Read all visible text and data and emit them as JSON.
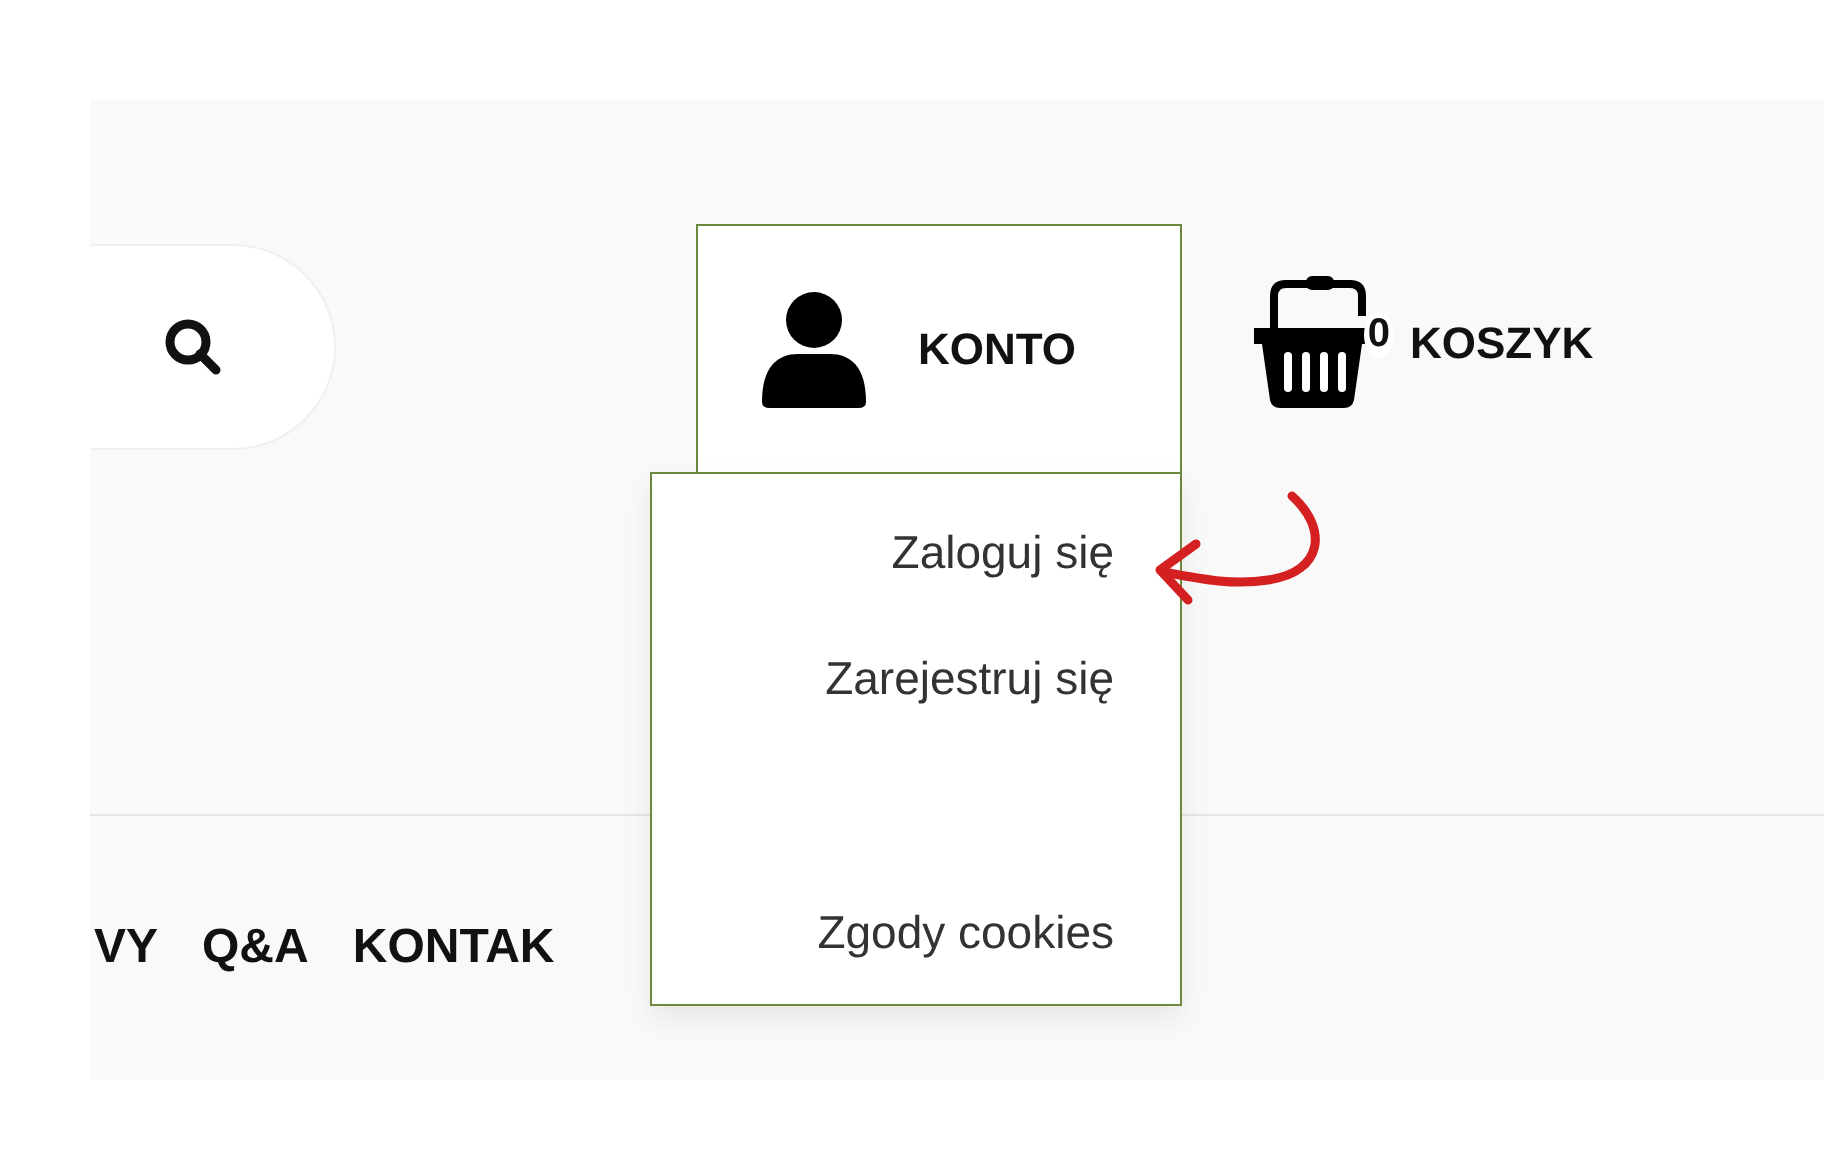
{
  "account": {
    "label": "KONTO",
    "expanded": true
  },
  "cart": {
    "count": "0",
    "label": "KOSZYK"
  },
  "account_menu": {
    "groups": [
      [
        {
          "label": "Zaloguj się"
        },
        {
          "label": "Zarejestruj się"
        }
      ],
      [
        {
          "label": "Zgody cookies"
        }
      ]
    ]
  },
  "nav": {
    "items": [
      "VY",
      "Q&A",
      "KONTAK"
    ]
  }
}
